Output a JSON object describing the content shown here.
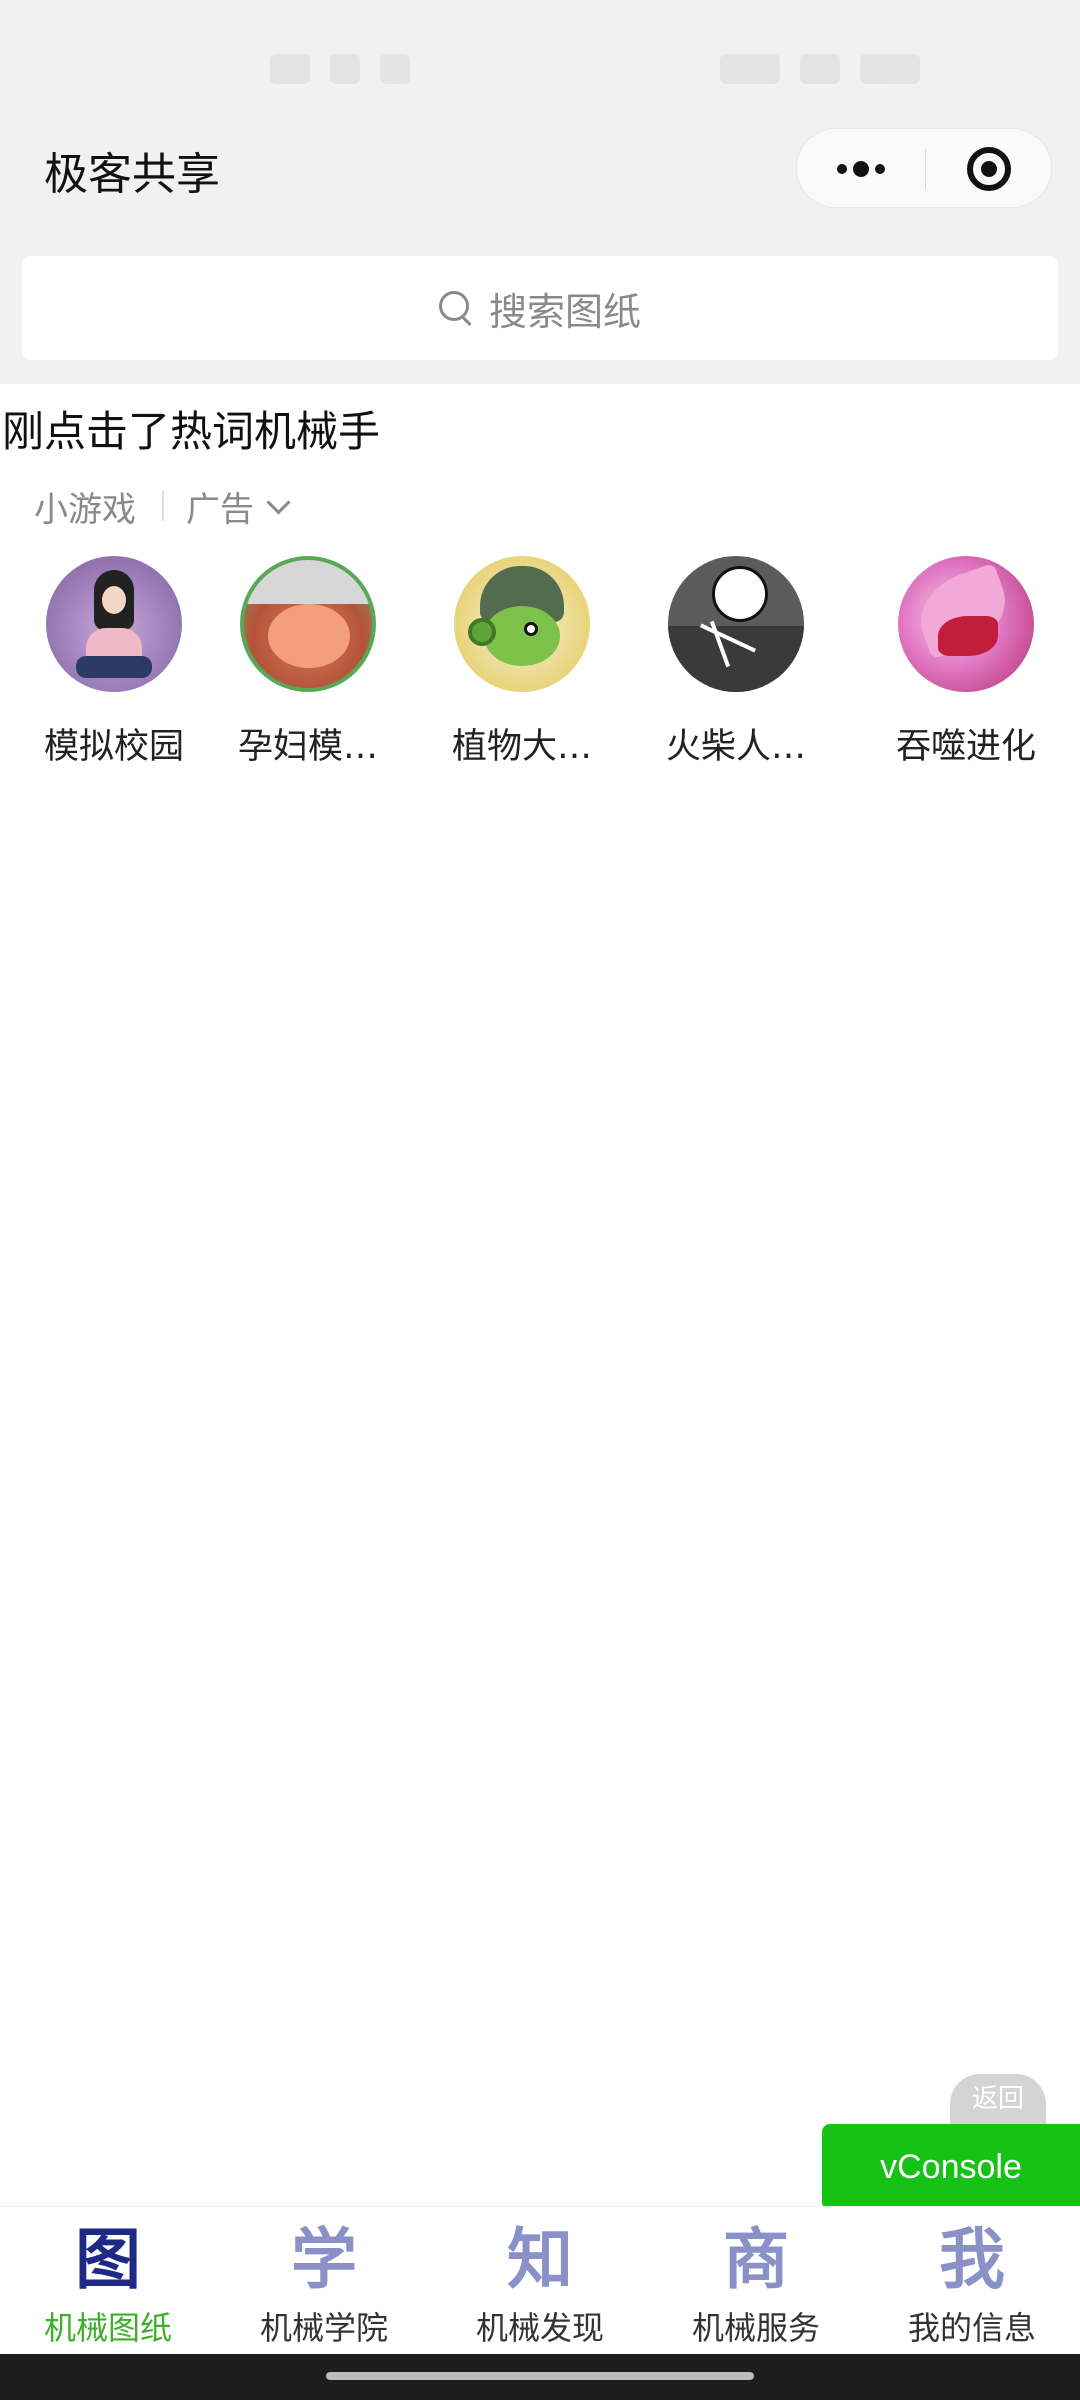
{
  "nav": {
    "title": "极客共享",
    "more_icon": "more-dots-icon",
    "close_icon": "target-icon"
  },
  "search": {
    "placeholder": "搜索图纸",
    "icon": "search-icon"
  },
  "hint": "刚点击了热词机械手",
  "ad": {
    "source_label": "小游戏",
    "ad_label": "广告",
    "games": [
      {
        "name": "模拟校园"
      },
      {
        "name": "孕妇模…"
      },
      {
        "name": "植物大…"
      },
      {
        "name": "火柴人…"
      },
      {
        "name": "吞噬进化"
      }
    ]
  },
  "floating": {
    "back_label": "返回",
    "vconsole_label": "vConsole",
    "vconsole_color": "#16c216"
  },
  "tabbar": {
    "active_color": "#3fae2a",
    "tabs": [
      {
        "glyph": "图",
        "label": "机械图纸"
      },
      {
        "glyph": "学",
        "label": "机械学院"
      },
      {
        "glyph": "知",
        "label": "机械发现"
      },
      {
        "glyph": "商",
        "label": "机械服务"
      },
      {
        "glyph": "我",
        "label": "我的信息"
      }
    ]
  }
}
